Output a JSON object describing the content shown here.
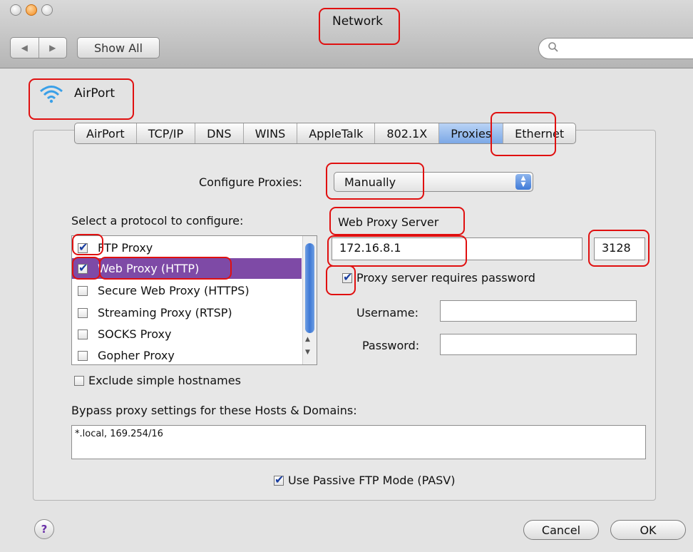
{
  "window": {
    "title": "Network"
  },
  "toolbar": {
    "show_all_label": "Show All",
    "back_glyph": "◀",
    "forward_glyph": "▶",
    "search_glyph": "🔍"
  },
  "header": {
    "interface_name": "AirPort",
    "icon": "wifi-icon"
  },
  "tabs": [
    {
      "label": "AirPort",
      "active": false
    },
    {
      "label": "TCP/IP",
      "active": false
    },
    {
      "label": "DNS",
      "active": false
    },
    {
      "label": "WINS",
      "active": false
    },
    {
      "label": "AppleTalk",
      "active": false
    },
    {
      "label": "802.1X",
      "active": false
    },
    {
      "label": "Proxies",
      "active": true
    },
    {
      "label": "Ethernet",
      "active": false
    }
  ],
  "configure": {
    "label": "Configure Proxies:",
    "value": "Manually"
  },
  "protocols": {
    "heading": "Select a protocol to configure:",
    "items": [
      {
        "label": "FTP Proxy",
        "checked": true,
        "selected": false
      },
      {
        "label": "Web Proxy (HTTP)",
        "checked": true,
        "selected": true
      },
      {
        "label": "Secure Web Proxy (HTTPS)",
        "checked": false,
        "selected": false
      },
      {
        "label": "Streaming Proxy (RTSP)",
        "checked": false,
        "selected": false
      },
      {
        "label": "SOCKS Proxy",
        "checked": false,
        "selected": false
      },
      {
        "label": "Gopher Proxy",
        "checked": false,
        "selected": false
      }
    ]
  },
  "server": {
    "heading": "Web Proxy Server",
    "host": "172.16.8.1",
    "port": "3128",
    "requires_password_label": "Proxy server requires password",
    "requires_password": true,
    "username_label": "Username:",
    "username": "",
    "password_label": "Password:",
    "password": ""
  },
  "exclude_simple": {
    "label": "Exclude simple hostnames",
    "checked": false
  },
  "bypass": {
    "label": "Bypass proxy settings for these Hosts & Domains:",
    "value": "*.local, 169.254/16"
  },
  "passive_ftp": {
    "label": "Use Passive FTP Mode (PASV)",
    "checked": true
  },
  "buttons": {
    "help": "?",
    "cancel": "Cancel",
    "ok": "OK"
  },
  "colors": {
    "selection": "#7e4aa6",
    "active_tab": "#7ca8e6",
    "annotation": "#e01010"
  }
}
